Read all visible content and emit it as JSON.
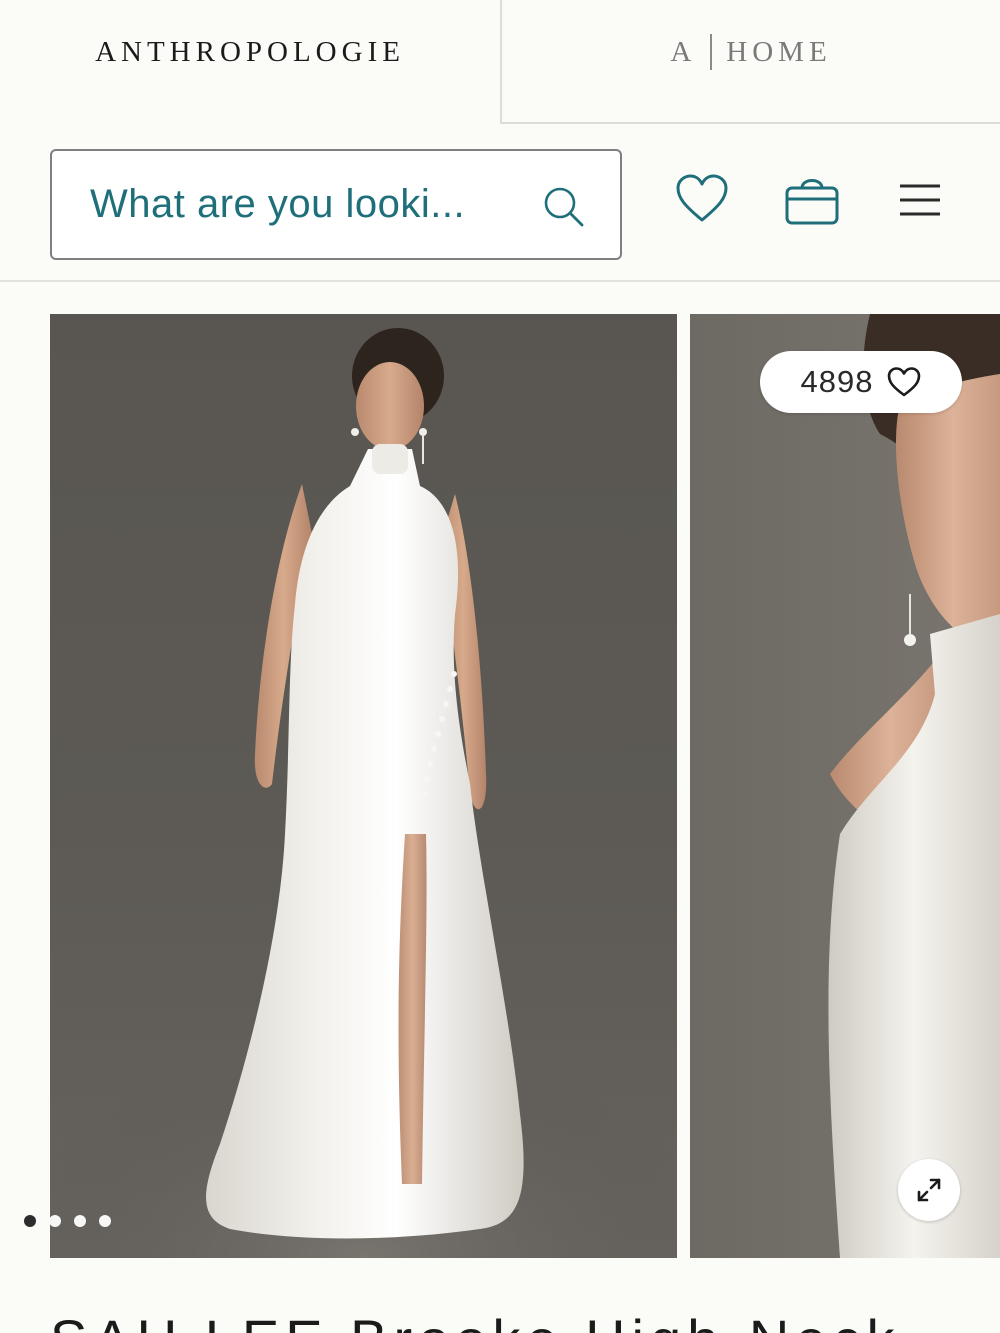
{
  "brand_tabs": {
    "main_logo": "ANTHROPOLOGIE",
    "home_logo_letter": "A",
    "home_logo_text": "HOME"
  },
  "header": {
    "search_placeholder": "What are you looki...",
    "icons": [
      "search-icon",
      "heart-icon",
      "shopping-bag-icon",
      "hamburger-menu-icon"
    ],
    "accent_color": "#1f6f7a"
  },
  "gallery": {
    "likes_count": "4898",
    "dots_total": 4,
    "dot_active_index": 0
  },
  "product": {
    "title": "SAU LEE Brooke High-Neck"
  }
}
